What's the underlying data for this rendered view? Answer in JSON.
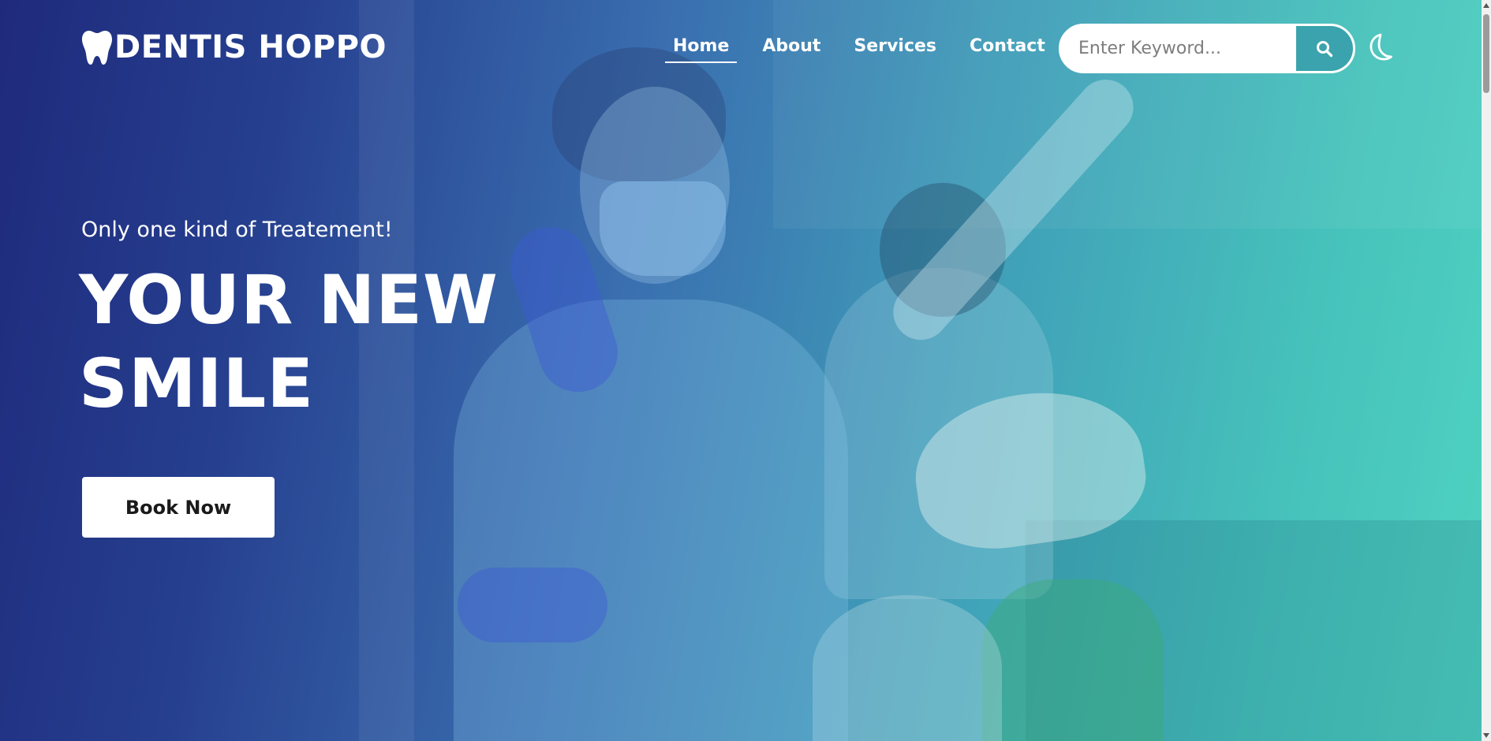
{
  "brand": {
    "name": "DENTIS HOPPO",
    "icon": "tooth-icon"
  },
  "nav": {
    "items": [
      {
        "label": "Home",
        "active": true
      },
      {
        "label": "About",
        "active": false
      },
      {
        "label": "Services",
        "active": false
      },
      {
        "label": "Contact",
        "active": false
      }
    ]
  },
  "search": {
    "placeholder": "Enter Keyword...",
    "value": "",
    "icon": "search-icon"
  },
  "theme_toggle": {
    "icon": "moon-icon"
  },
  "hero": {
    "tagline": "Only one kind of Treatement!",
    "headline_line1": "YOUR NEW",
    "headline_line2": "SMILE",
    "cta_label": "Book Now"
  },
  "colors": {
    "gradient_start": "#1f2a7c",
    "gradient_end": "#4fd3c2",
    "search_button": "#3aa3ad",
    "text": "#ffffff"
  }
}
